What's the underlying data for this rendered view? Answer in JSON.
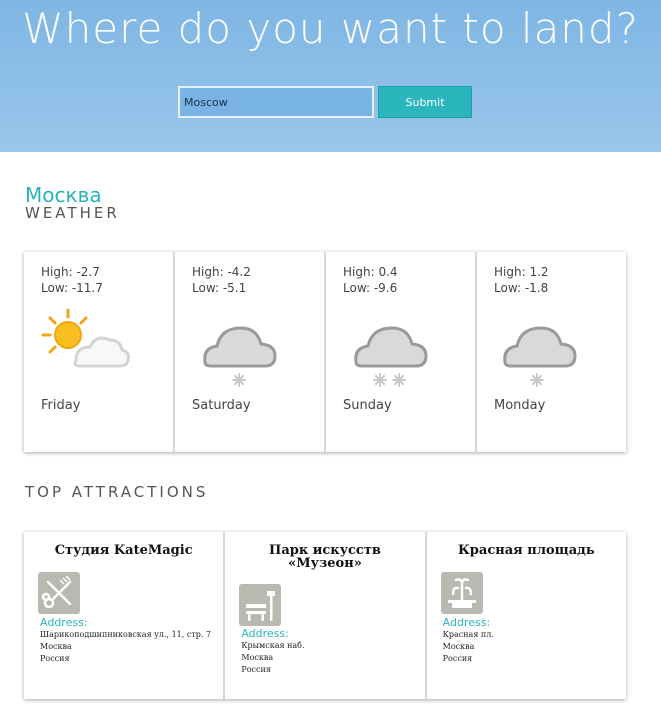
{
  "hero": {
    "title": "Where do you want to land?"
  },
  "search": {
    "value": "Moscow",
    "submit_label": "Submit"
  },
  "city": {
    "name": "Москва",
    "weather_label": "WEATHER"
  },
  "forecast": [
    {
      "high": "High: -2.7",
      "low": "Low: -11.7",
      "day": "Friday",
      "icon": "partly-cloudy-icon"
    },
    {
      "high": "High: -4.2",
      "low": "Low: -5.1",
      "day": "Saturday",
      "icon": "snow-light-icon"
    },
    {
      "high": "High: 0.4",
      "low": "Low: -9.6",
      "day": "Sunday",
      "icon": "snow-icon"
    },
    {
      "high": "High: 1.2",
      "low": "Low: -1.8",
      "day": "Monday",
      "icon": "snow-light-icon"
    }
  ],
  "attractions_label": "TOP ATTRACTIONS",
  "attractions": [
    {
      "name_line1": "Студия KateMagic",
      "name_line2": "",
      "icon": "scissors-comb-icon",
      "address_label": "Address:",
      "address": [
        "Шарикоподшипниковская ул., 11, стр. 7",
        "Москва",
        "Россия"
      ]
    },
    {
      "name_line1": "Парк искусств",
      "name_line2": "«Музеон»",
      "icon": "park-bench-icon",
      "address_label": "Address:",
      "address": [
        "Крымская наб.",
        "Москва",
        "Россия"
      ]
    },
    {
      "name_line1": "Красная площадь",
      "name_line2": "",
      "icon": "fountain-icon",
      "address_label": "Address:",
      "address": [
        "Красная пл.",
        "Москва",
        "Россия"
      ]
    }
  ]
}
